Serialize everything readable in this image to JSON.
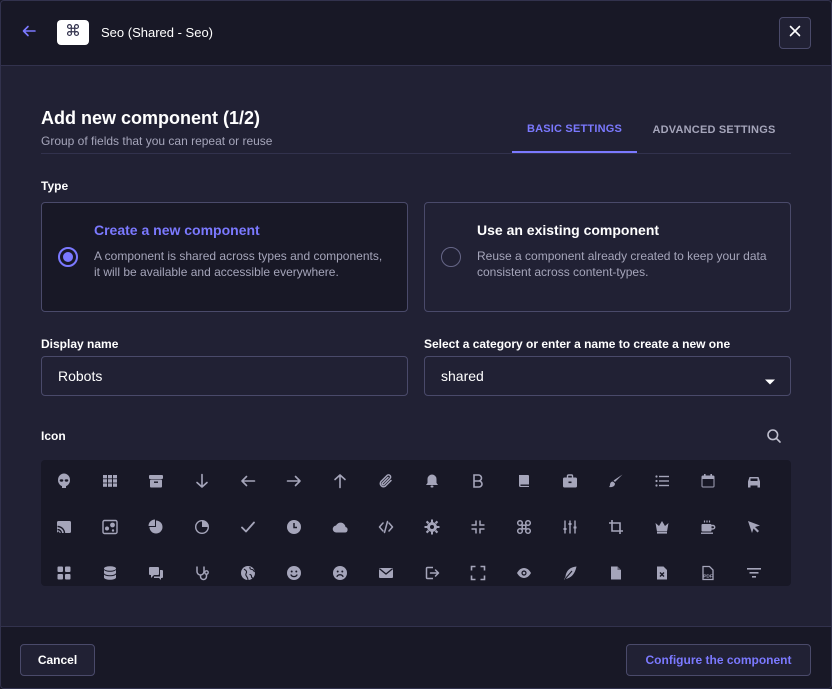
{
  "header": {
    "title": "Seo (Shared - Seo)",
    "back_icon": "arrow-left-icon",
    "component_icon": "command-icon",
    "close_icon": "close-icon"
  },
  "main": {
    "title": "Add new component (1/2)",
    "subtitle": "Group of fields that you can repeat or reuse",
    "tabs": [
      {
        "label": "BASIC SETTINGS",
        "active": true
      },
      {
        "label": "ADVANCED SETTINGS",
        "active": false
      }
    ]
  },
  "type_section": {
    "label": "Type",
    "options": [
      {
        "title": "Create a new component",
        "description": "A component is shared across types and components, it will be available and accessible everywhere.",
        "selected": true
      },
      {
        "title": "Use an existing component",
        "description": "Reuse a component already created to keep your data consistent across content-types.",
        "selected": false
      }
    ]
  },
  "display_name": {
    "label": "Display name",
    "value": "Robots"
  },
  "category": {
    "label": "Select a category or enter a name to create a new one",
    "value": "shared",
    "caret_icon": "caret-down-icon"
  },
  "icon_section": {
    "label": "Icon",
    "search_icon": "search-icon",
    "icons": [
      "alien-icon",
      "apps-icon",
      "archive-icon",
      "arrow-down-icon",
      "arrow-left-icon",
      "arrow-right-icon",
      "arrow-up-icon",
      "paperclip-icon",
      "bell-icon",
      "bold-icon",
      "book-icon",
      "briefcase-icon",
      "brush-icon",
      "bullet-list-icon",
      "calendar-icon",
      "car-icon",
      "cast-icon",
      "chart-bubble-icon",
      "chart-circle-icon",
      "chart-pie-icon",
      "check-icon",
      "clock-icon",
      "cloud-icon",
      "code-icon",
      "cog-icon",
      "collapse-icon",
      "command-icon",
      "controls-icon",
      "crop-icon",
      "crown-icon",
      "cup-icon",
      "cursor-icon",
      "dashboard-icon",
      "database-icon",
      "discuss-icon",
      "doctor-icon",
      "earth-icon",
      "emotion-happy-icon",
      "emotion-unhappy-icon",
      "envelope-icon",
      "exit-icon",
      "expand-icon",
      "eye-icon",
      "feather-icon",
      "file-icon",
      "file-error-icon",
      "file-pdf-icon",
      "filter-icon"
    ]
  },
  "footer": {
    "cancel_label": "Cancel",
    "confirm_label": "Configure the component"
  },
  "colors": {
    "accent": "#7b79ff",
    "background": "#212134",
    "surface": "#181826",
    "border": "#4a4a6a",
    "muted_text": "#a5a5ba",
    "icon": "#a5a5ba"
  }
}
